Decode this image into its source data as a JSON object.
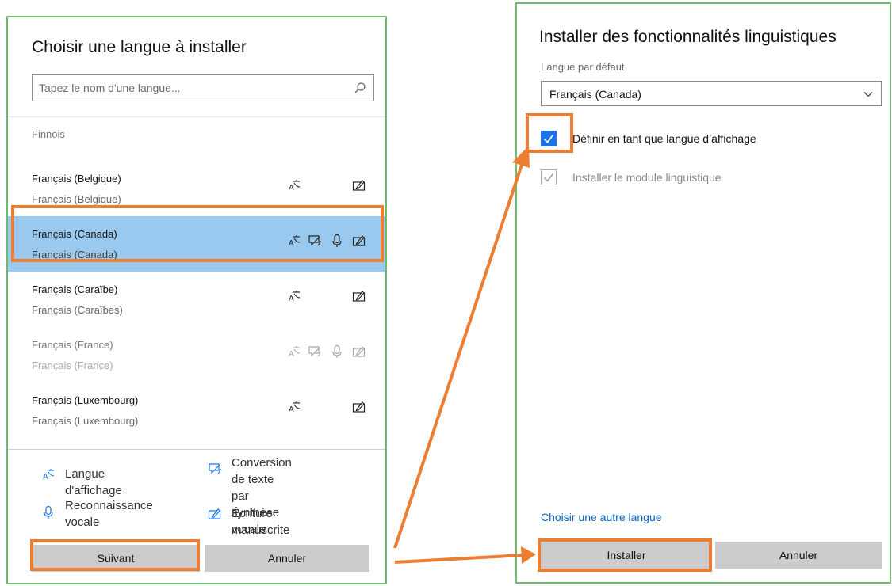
{
  "left": {
    "title": "Choisir une langue à installer",
    "search_placeholder": "Tapez le nom d'une langue...",
    "group_header": "Finnois",
    "languages": [
      {
        "name": "Français (Belgique)",
        "native": "Français (Belgique)",
        "features": [
          "display-language",
          "handwriting"
        ],
        "state": "normal"
      },
      {
        "name": "Français (Canada)",
        "native": "Français (Canada)",
        "features": [
          "display-language",
          "text-to-speech",
          "speech-recognition",
          "handwriting"
        ],
        "state": "selected"
      },
      {
        "name": "Français (Caraïbe)",
        "native": "Français (Caraïbes)",
        "features": [
          "display-language",
          "handwriting"
        ],
        "state": "normal"
      },
      {
        "name": "Français (France)",
        "native": "Français (France)",
        "features": [
          "display-language",
          "text-to-speech",
          "speech-recognition",
          "handwriting"
        ],
        "state": "disabled"
      },
      {
        "name": "Français (Luxembourg)",
        "native": "Français (Luxembourg)",
        "features": [
          "display-language",
          "handwriting"
        ],
        "state": "normal"
      }
    ],
    "legend": {
      "display_language": "Langue d'affichage",
      "tts_line1": "Conversion de texte",
      "tts_line2": "par synthèse vocale",
      "speech_line1": "Reconnaissance",
      "speech_line2": "vocale",
      "handwriting": "Écriture manuscrite"
    },
    "next_button": "Suivant",
    "cancel_button": "Annuler"
  },
  "right": {
    "title": "Installer des fonctionnalités linguistiques",
    "default_language_label": "Langue par défaut",
    "default_language_value": "Français (Canada)",
    "checkbox_display": {
      "label": "Définir en tant que langue d’affichage",
      "checked": true,
      "enabled": true
    },
    "checkbox_pack": {
      "label": "Installer le module linguistique",
      "checked": true,
      "enabled": false
    },
    "link": "Choisir une autre langue",
    "install_button": "Installer",
    "cancel_button": "Annuler"
  },
  "colors": {
    "highlight": "#ed7d31",
    "selection": "#99c9ef",
    "panel_border": "#6dbb6d",
    "accent": "#1a73e8",
    "link": "#0a66c2",
    "button": "#cccccc"
  }
}
